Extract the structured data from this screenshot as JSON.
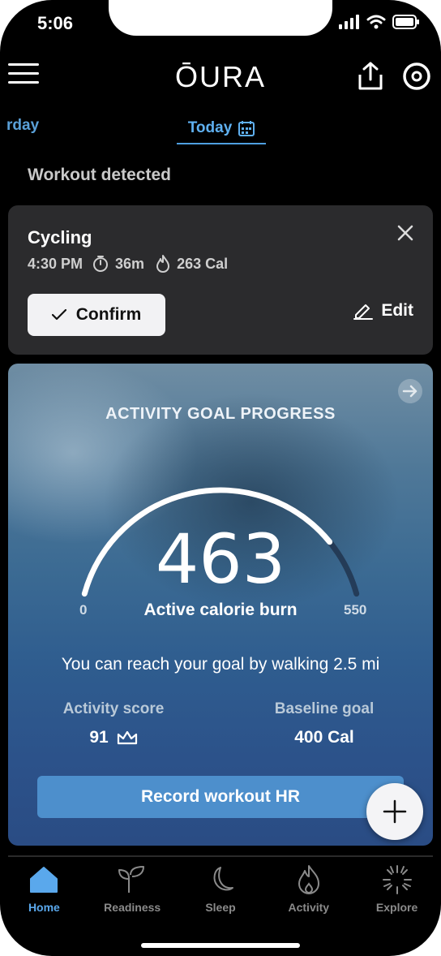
{
  "status": {
    "time": "5:06"
  },
  "header": {
    "logo": "ŌURA"
  },
  "date_nav": {
    "previous": "rday",
    "current": "Today"
  },
  "workout": {
    "section_title": "Workout detected",
    "type": "Cycling",
    "time": "4:30 PM",
    "duration": "36m",
    "calories": "263 Cal",
    "confirm_label": "Confirm",
    "edit_label": "Edit"
  },
  "activity": {
    "heading": "ACTIVITY GOAL PROGRESS",
    "value": "463",
    "label": "Active calorie burn",
    "min": "0",
    "max": "550",
    "progress_fraction": 0.84,
    "suggestion": "You can reach your goal by walking 2.5 mi",
    "score_label": "Activity score",
    "score_value": "91",
    "goal_label": "Baseline goal",
    "goal_value": "400 Cal",
    "record_label": "Record workout HR"
  },
  "tabs": [
    {
      "label": "Home",
      "icon": "home-icon",
      "active": true
    },
    {
      "label": "Readiness",
      "icon": "sprout-icon",
      "active": false
    },
    {
      "label": "Sleep",
      "icon": "moon-icon",
      "active": false
    },
    {
      "label": "Activity",
      "icon": "flame-icon",
      "active": false
    },
    {
      "label": "Explore",
      "icon": "sparkle-icon",
      "active": false
    }
  ],
  "colors": {
    "accent": "#5aa8ec",
    "card_bg": "#2b2b2d",
    "record_button": "#4d8fcc"
  }
}
